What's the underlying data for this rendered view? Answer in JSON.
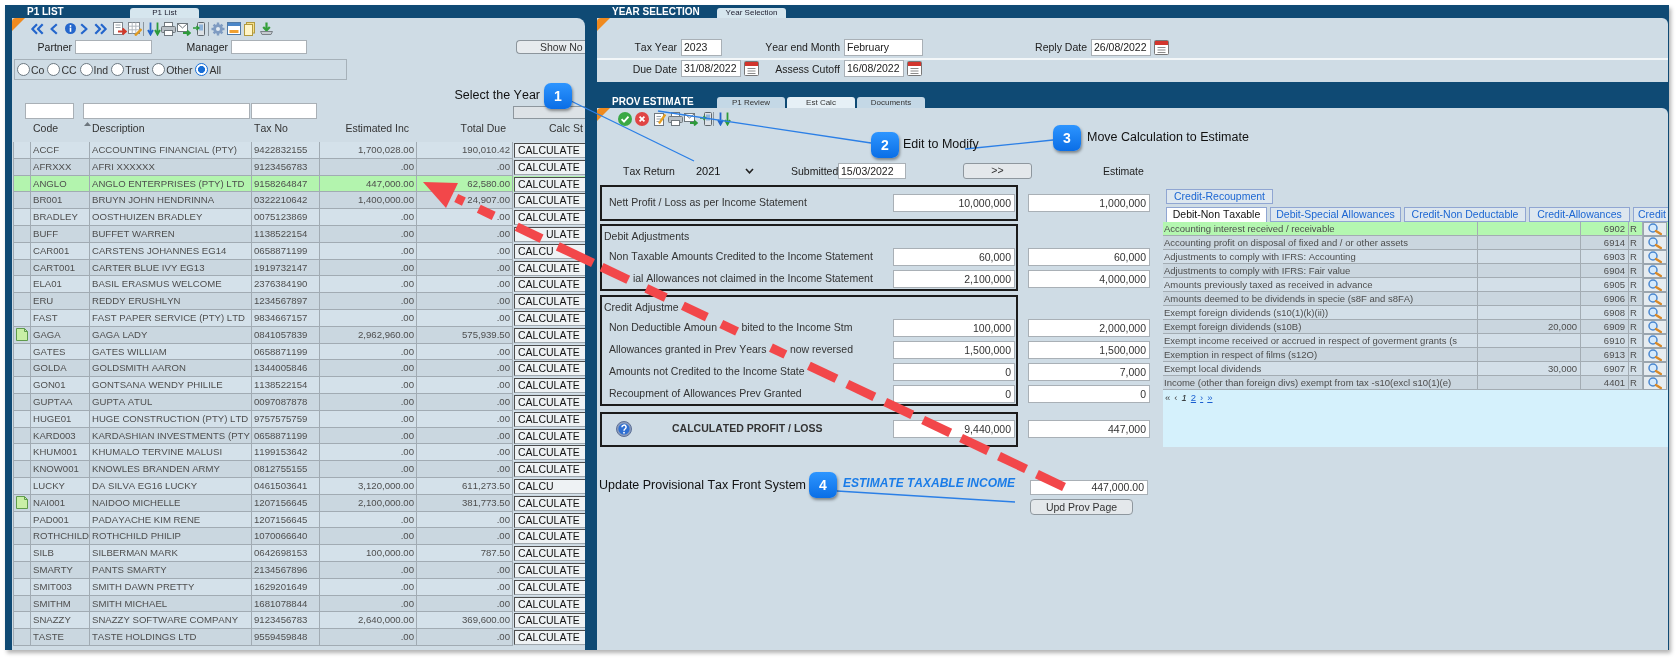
{
  "p1_list": {
    "title": "P1 LIST",
    "tab": "P1 List",
    "partner_label": "Partner",
    "manager_label": "Manager",
    "show_button": "Show No",
    "entity_types": [
      {
        "label": "Co",
        "selected": false
      },
      {
        "label": "CC",
        "selected": false
      },
      {
        "label": "Ind",
        "selected": false
      },
      {
        "label": "Trust",
        "selected": false
      },
      {
        "label": "Other",
        "selected": false
      },
      {
        "label": "All",
        "selected": true
      }
    ],
    "columns": [
      {
        "label": "Code",
        "sorted": false
      },
      {
        "label": "Description",
        "sorted": true
      },
      {
        "label": "Tax No",
        "sorted": false
      },
      {
        "label": "Estimated Inc",
        "sorted": false
      },
      {
        "label": "Total Due",
        "sorted": false
      },
      {
        "label": "Calc St",
        "sorted": false
      }
    ],
    "rows": [
      {
        "code": "ACCF",
        "description": "ACCOUNTING FINANCIAL (PTY)",
        "tax_no": "9422832155",
        "estimated_inc": "1,700,028.00",
        "total_due": "190,010.42",
        "calc_status": "CALCULATE",
        "note": false,
        "selected": false
      },
      {
        "code": "AFRXXX",
        "description": "AFRI XXXXXX",
        "tax_no": "9123456783",
        "estimated_inc": ".00",
        "total_due": ".00",
        "calc_status": "CALCULATE",
        "note": false,
        "selected": false
      },
      {
        "code": "ANGLO",
        "description": "ANGLO ENTERPRISES (PTY) LTD",
        "tax_no": "9158264847",
        "estimated_inc": "447,000.00",
        "total_due": "62,580.00",
        "calc_status": "CALCULATE",
        "note": false,
        "selected": true
      },
      {
        "code": "BR001",
        "description": "BRUYN JOHN HENDRINNA",
        "tax_no": "0322210642",
        "estimated_inc": "1,400,000.00",
        "total_due": "24,907.00",
        "calc_status": "CALCULATE",
        "note": false,
        "selected": false
      },
      {
        "code": "BRADLEY",
        "description": "OOSTHUIZEN BRADLEY",
        "tax_no": "0075123869",
        "estimated_inc": ".00",
        "total_due": ".00",
        "calc_status": "CALCULATE",
        "note": false,
        "selected": false
      },
      {
        "code": "BUFF",
        "description": "BUFFET WARREN",
        "tax_no": "1138522154",
        "estimated_inc": ".00",
        "total_due": ".00",
        "calc_status": "ULATE",
        "note": false,
        "selected": false
      },
      {
        "code": "CAR001",
        "description": "CARSTENS JOHANNES EG14",
        "tax_no": "0658871199",
        "estimated_inc": ".00",
        "total_due": ".00",
        "calc_status": "CALCU",
        "note": false,
        "selected": false
      },
      {
        "code": "CART001",
        "description": "CARTER BLUE IVY EG13",
        "tax_no": "1919732147",
        "estimated_inc": ".00",
        "total_due": ".00",
        "calc_status": "CALCULATE",
        "note": false,
        "selected": false
      },
      {
        "code": "ELA01",
        "description": "BASIL ERASMUS WELCOME",
        "tax_no": "2376384190",
        "estimated_inc": ".00",
        "total_due": ".00",
        "calc_status": "CALCULATE",
        "note": false,
        "selected": false
      },
      {
        "code": "ERU",
        "description": "REDDY ERUSHLYN",
        "tax_no": "1234567897",
        "estimated_inc": ".00",
        "total_due": ".00",
        "calc_status": "CALCULATE",
        "note": false,
        "selected": false
      },
      {
        "code": "FAST",
        "description": "FAST PAPER SERVICE (PTY) LTD",
        "tax_no": "9834667157",
        "estimated_inc": ".00",
        "total_due": ".00",
        "calc_status": "CALCULATE",
        "note": false,
        "selected": false
      },
      {
        "code": "GAGA",
        "description": "GAGA LADY",
        "tax_no": "0841057839",
        "estimated_inc": "2,962,960.00",
        "total_due": "575,939.50",
        "calc_status": "CALCULATE",
        "note": true,
        "selected": false
      },
      {
        "code": "GATES",
        "description": "GATES WILLIAM",
        "tax_no": "0658871199",
        "estimated_inc": ".00",
        "total_due": ".00",
        "calc_status": "CALCULATE",
        "note": false,
        "selected": false
      },
      {
        "code": "GOLDA",
        "description": "GOLDSMITH AARON",
        "tax_no": "1344005846",
        "estimated_inc": ".00",
        "total_due": ".00",
        "calc_status": "CALCULATE",
        "note": false,
        "selected": false
      },
      {
        "code": "GON01",
        "description": "GONTSANA WENDY PHILILE",
        "tax_no": "1138522154",
        "estimated_inc": ".00",
        "total_due": ".00",
        "calc_status": "CALCULATE",
        "note": false,
        "selected": false
      },
      {
        "code": "GUPTAA",
        "description": "GUPTA ATUL",
        "tax_no": "0097087878",
        "estimated_inc": ".00",
        "total_due": ".00",
        "calc_status": "CALCULATE",
        "note": false,
        "selected": false
      },
      {
        "code": "HUGE01",
        "description": "HUGE CONSTRUCTION (PTY) LTD",
        "tax_no": "9757575759",
        "estimated_inc": ".00",
        "total_due": ".00",
        "calc_status": "CALCULATE",
        "note": false,
        "selected": false
      },
      {
        "code": "KARD003",
        "description": "KARDASHIAN INVESTMENTS (PTY",
        "tax_no": "0658871199",
        "estimated_inc": ".00",
        "total_due": ".00",
        "calc_status": "CALCULATE",
        "note": false,
        "selected": false
      },
      {
        "code": "KHUM001",
        "description": "KHUMALO TERVINE MALUSI",
        "tax_no": "1199153642",
        "estimated_inc": ".00",
        "total_due": ".00",
        "calc_status": "CALCULATE",
        "note": false,
        "selected": false
      },
      {
        "code": "KNOW001",
        "description": "KNOWLES BRANDEN ARMY",
        "tax_no": "0812755155",
        "estimated_inc": ".00",
        "total_due": ".00",
        "calc_status": "CALCULATE",
        "note": false,
        "selected": false
      },
      {
        "code": "LUCKY",
        "description": "DA SILVA EG16 LUCKY",
        "tax_no": "0461503641",
        "estimated_inc": "3,120,000.00",
        "total_due": "611,273.50",
        "calc_status": "CALCU",
        "note": false,
        "selected": false
      },
      {
        "code": "NAI001",
        "description": "NAIDOO MICHELLE",
        "tax_no": "1207156645",
        "estimated_inc": "2,100,000.00",
        "total_due": "381,773.50",
        "calc_status": "CALCULATE",
        "note": true,
        "selected": false
      },
      {
        "code": "PAD001",
        "description": "PADAYACHE KIM RENE",
        "tax_no": "1207156645",
        "estimated_inc": ".00",
        "total_due": ".00",
        "calc_status": "CALCULATE",
        "note": false,
        "selected": false
      },
      {
        "code": "ROTHCHILD",
        "description": "ROTHCHILD PHILIP",
        "tax_no": "1070066640",
        "estimated_inc": ".00",
        "total_due": ".00",
        "calc_status": "CALCULATE",
        "note": false,
        "selected": false
      },
      {
        "code": "SILB",
        "description": "SILBERMAN MARK",
        "tax_no": "0642698153",
        "estimated_inc": "100,000.00",
        "total_due": "787.50",
        "calc_status": "CALCULATE",
        "note": false,
        "selected": false
      },
      {
        "code": "SMARTY",
        "description": "PANTS SMARTY",
        "tax_no": "2134567896",
        "estimated_inc": ".00",
        "total_due": ".00",
        "calc_status": "CALCULATE",
        "note": false,
        "selected": false
      },
      {
        "code": "SMIT003",
        "description": "SMITH DAWN PRETTY",
        "tax_no": "1629201649",
        "estimated_inc": ".00",
        "total_due": ".00",
        "calc_status": "CALCULATE",
        "note": false,
        "selected": false
      },
      {
        "code": "SMITHM",
        "description": "SMITH MICHAEL",
        "tax_no": "1681078844",
        "estimated_inc": ".00",
        "total_due": ".00",
        "calc_status": "CALCULATE",
        "note": false,
        "selected": false
      },
      {
        "code": "SNAZZY",
        "description": "SNAZZY SOFTWARE COMPANY",
        "tax_no": "9123456783",
        "estimated_inc": "2,640,000.00",
        "total_due": "369,600.00",
        "calc_status": "CALCULATE",
        "note": false,
        "selected": false
      },
      {
        "code": "TASTE",
        "description": "TASTE HOLDINGS LTD",
        "tax_no": "9559459848",
        "estimated_inc": ".00",
        "total_due": ".00",
        "calc_status": "CALCULATE",
        "note": false,
        "selected": false
      }
    ]
  },
  "year_selection": {
    "title": "YEAR SELECTION",
    "tab": "Year Selection",
    "fields": [
      {
        "label": "Tax Year",
        "value": "2023",
        "kind": "text"
      },
      {
        "label": "Year end Month",
        "value": "February",
        "kind": "text"
      },
      {
        "label": "Reply Date",
        "value": "26/08/2022",
        "kind": "date"
      },
      {
        "label": "Due Date",
        "value": "31/08/2022",
        "kind": "date"
      },
      {
        "label": "Assess Cutoff",
        "value": "16/08/2022",
        "kind": "date"
      }
    ]
  },
  "prov_estimate": {
    "title": "PROV ESTIMATE",
    "tabs": [
      {
        "label": "P1 Review",
        "selected": false
      },
      {
        "label": "Est Calc",
        "selected": true
      },
      {
        "label": "Documents",
        "selected": false
      }
    ],
    "tax_return": {
      "label": "Tax Return",
      "value": "2021"
    },
    "submitted": {
      "label": "Submitted",
      "value": "15/03/2022"
    },
    "move_button": ">>",
    "estimate_heading": "Estimate",
    "sections": [
      {
        "kind": "lines",
        "lines": [
          {
            "label": "Nett Profit / Loss as per Income Statement",
            "return_value": "10,000,000",
            "estimate_value": "1,000,000"
          }
        ]
      },
      {
        "kind": "lines",
        "heading": "Debit Adjustments",
        "lines": [
          {
            "label": "Non Taxable Amounts Credited to the Income Statement",
            "return_value": "60,000",
            "estimate_value": "60,000"
          },
          {
            "label": "ial Allowances not claimed in the Income Statement",
            "return_value": "2,100,000",
            "estimate_value": "4,000,000"
          }
        ]
      },
      {
        "kind": "lines",
        "heading": "Credit Adjustme",
        "lines": [
          {
            "label": [
              "Non Deductible Amoun",
              "bited to the Income Stm"
            ],
            "return_value": "100,000",
            "estimate_value": "2,000,000"
          },
          {
            "label": [
              "Allowances granted in Prev Years",
              "now reversed"
            ],
            "return_value": "1,500,000",
            "estimate_value": "1,500,000"
          },
          {
            "label": "Amounts not Credited to the Income State",
            "return_value": "0",
            "estimate_value": "7,000"
          },
          {
            "label": "Recoupment of Allowances Prev Granted",
            "return_value": "0",
            "estimate_value": "0"
          }
        ]
      },
      {
        "kind": "total",
        "label": "CALCULATED PROFIT / LOSS",
        "return_value": "9,440,000",
        "estimate_value": "447,000"
      }
    ],
    "taxable_income": {
      "label": "ESTIMATE TAXABLE INCOME",
      "value": "447,000.00"
    },
    "update_button": "Upd Prov Page"
  },
  "adjustment_codes": {
    "tab_rows": [
      [
        {
          "label": "Credit-Recoupment",
          "selected": false
        }
      ],
      [
        {
          "label": "Debit-Non Taxable",
          "selected": true
        },
        {
          "label": "Debit-Special Allowances",
          "selected": false
        },
        {
          "label": "Credit-Non Deductable",
          "selected": false
        },
        {
          "label": "Credit-Allowances",
          "selected": false
        },
        {
          "label": "Credit",
          "selected": false
        }
      ]
    ],
    "rows": [
      {
        "description": "Accounting interest received / receivable",
        "code": "6902",
        "flag": "R",
        "selected": true
      },
      {
        "description": "Accounting profit on disposal of fixed and / or other assets",
        "code": "6914",
        "flag": "R",
        "selected": false
      },
      {
        "description": "Adjustments to comply with IFRS: Accounting",
        "code": "6903",
        "flag": "R",
        "selected": false
      },
      {
        "description": "Adjustments to comply with IFRS: Fair value",
        "code": "6904",
        "flag": "R",
        "selected": false
      },
      {
        "description": "Amounts previously taxed as received in advance",
        "code": "6905",
        "flag": "R",
        "selected": false
      },
      {
        "description": "Amounts deemed to be dividends in specie (s8F and s8FA)",
        "code": "6906",
        "flag": "R",
        "selected": false
      },
      {
        "description": "Exempt foreign dividends (s10(1)(k)(ii))",
        "code": "6908",
        "flag": "R",
        "selected": false
      },
      {
        "description": "Exempt foreign dividends (s10B)",
        "amount": "20,000",
        "code": "6909",
        "flag": "R",
        "selected": false
      },
      {
        "description": "Exempt income received or accrued in respect of goverment grants (s",
        "code": "6910",
        "flag": "R",
        "selected": false
      },
      {
        "description": "Exemption in respect of films (s12O)",
        "code": "6913",
        "flag": "R",
        "selected": false
      },
      {
        "description": "Exempt local dividends",
        "amount": "30,000",
        "code": "6907",
        "flag": "R",
        "selected": false
      },
      {
        "description": "Income (other than foreign divs) exempt from tax -s10(excl s10(1)(e)",
        "code": "4401",
        "flag": "R",
        "selected": false
      }
    ],
    "pagination": [
      {
        "label": "«",
        "disabled": true,
        "selected": false
      },
      {
        "label": "‹",
        "disabled": true,
        "selected": false
      },
      {
        "label": "1",
        "disabled": false,
        "selected": true
      },
      {
        "label": "2",
        "disabled": false,
        "selected": false
      },
      {
        "label": "›",
        "disabled": false,
        "selected": false
      },
      {
        "label": "»",
        "disabled": false,
        "selected": false
      }
    ]
  },
  "callouts": [
    {
      "number": "1",
      "text": "Select the Year"
    },
    {
      "number": "2",
      "text": "Edit to Modify"
    },
    {
      "number": "3",
      "text": "Move Calculation to Estimate"
    },
    {
      "number": "4",
      "text": "Update Provisional Tax Front System"
    }
  ]
}
